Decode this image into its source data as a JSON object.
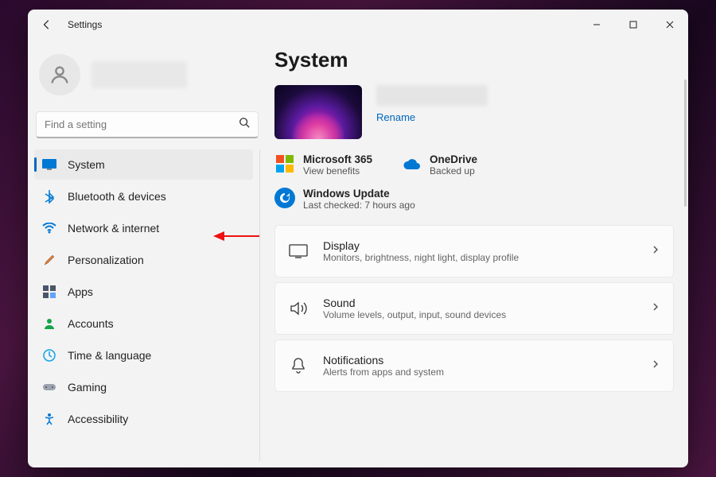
{
  "window": {
    "title": "Settings"
  },
  "search": {
    "placeholder": "Find a setting"
  },
  "nav": {
    "items": [
      {
        "label": "System",
        "selected": true
      },
      {
        "label": "Bluetooth & devices"
      },
      {
        "label": "Network & internet"
      },
      {
        "label": "Personalization"
      },
      {
        "label": "Apps"
      },
      {
        "label": "Accounts"
      },
      {
        "label": "Time & language"
      },
      {
        "label": "Gaming"
      },
      {
        "label": "Accessibility"
      }
    ]
  },
  "page": {
    "title": "System",
    "rename": "Rename",
    "status": {
      "microsoft365": {
        "title": "Microsoft 365",
        "sub": "View benefits"
      },
      "onedrive": {
        "title": "OneDrive",
        "sub": "Backed up"
      },
      "windowsUpdate": {
        "title": "Windows Update",
        "sub": "Last checked: 7 hours ago"
      }
    },
    "cards": [
      {
        "title": "Display",
        "sub": "Monitors, brightness, night light, display profile"
      },
      {
        "title": "Sound",
        "sub": "Volume levels, output, input, sound devices"
      },
      {
        "title": "Notifications",
        "sub": "Alerts from apps and system"
      }
    ]
  },
  "colors": {
    "accent": "#0067c0"
  }
}
